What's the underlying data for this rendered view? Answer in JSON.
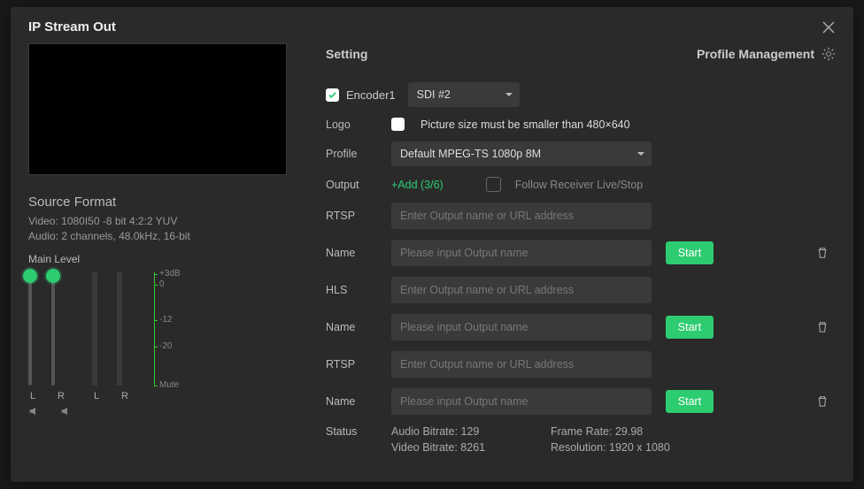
{
  "title": "IP Stream Out",
  "left": {
    "source_format_title": "Source Format",
    "video_line": "Video: 1080I50 -8 bit 4:2:2 YUV",
    "audio_line": "Audio: 2 channels, 48.0kHz, 16-bit",
    "main_level": "Main Level",
    "db_labels": {
      "top1": "+3dB",
      "top2": "0",
      "mid": "-12",
      "low": "-20",
      "mute": "Mute"
    },
    "L": "L",
    "R": "R"
  },
  "right": {
    "setting": "Setting",
    "profile_mgmt": "Profile Management",
    "encoder_label": "Encoder1",
    "encoder_source": "SDI #2",
    "logo_label": "Logo",
    "logo_hint": "Picture size must be smaller than 480×640",
    "profile_label": "Profile",
    "profile_value": "Default MPEG-TS 1080p 8M",
    "output_label": "Output",
    "add_link": "+Add (3/6)",
    "follow_label": "Follow Receiver Live/Stop",
    "url_placeholder": "Enter Output name or URL address",
    "name_placeholder": "Please input Output name",
    "name_label": "Name",
    "rtsp_label": "RTSP",
    "hls_label": "HLS",
    "start": "Start",
    "status_label": "Status",
    "status": {
      "audio_bitrate": "Audio Bitrate: 129",
      "video_bitrate": "Video Bitrate: 8261",
      "frame_rate": "Frame Rate: 29.98",
      "resolution": "Resolution: 1920 x 1080"
    }
  }
}
